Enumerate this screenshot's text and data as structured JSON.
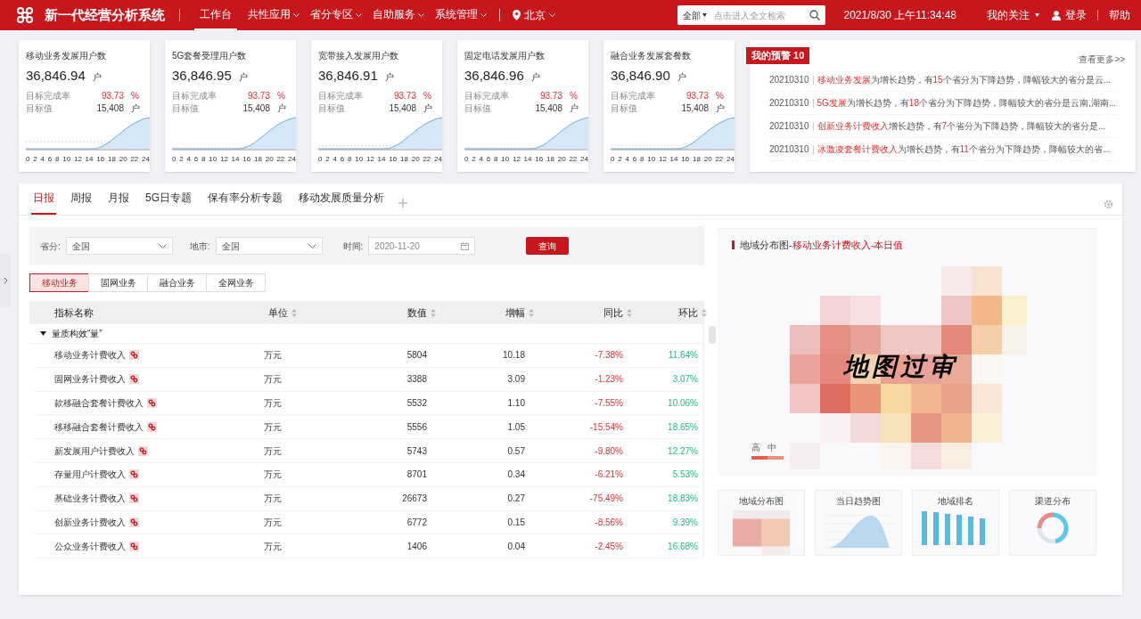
{
  "header": {
    "title": "新一代经营分析系统",
    "nav": [
      {
        "label": "工作台",
        "selected": true,
        "dropdown": false
      },
      {
        "label": "共性应用",
        "selected": false,
        "dropdown": true
      },
      {
        "label": "省分专区",
        "selected": false,
        "dropdown": true
      },
      {
        "label": "自助服务",
        "selected": false,
        "dropdown": true
      },
      {
        "label": "系统管理",
        "selected": false,
        "dropdown": true
      }
    ],
    "location": "北京",
    "search": {
      "scope": "全部",
      "placeholder": "点击进入全文检索"
    },
    "datetime": "2021/8/30 上午11:34:48",
    "follow": "我的关注",
    "login": "登录",
    "help": "帮助"
  },
  "kpi_cards": [
    {
      "title": "移动业务发展用户数",
      "value": "36,846.94",
      "unit": "户",
      "rate_label": "目标完成率",
      "rate": "93.73",
      "rate_unit": "%",
      "target_label": "目标值",
      "target": "15,408",
      "target_unit": "户",
      "axis": "0 2 4 6 8 10 12 14 16 18 20 22 24"
    },
    {
      "title": "5G套餐受理用户数",
      "value": "36,846.95",
      "unit": "户",
      "rate_label": "目标完成率",
      "rate": "93.73",
      "rate_unit": "%",
      "target_label": "目标值",
      "target": "15,408",
      "target_unit": "户",
      "axis": "0 2 4 6 8 10 12 14 16 18 20 22 24"
    },
    {
      "title": "宽带接入发展用户数",
      "value": "36,846.91",
      "unit": "户",
      "rate_label": "目标完成率",
      "rate": "93.73",
      "rate_unit": "%",
      "target_label": "目标值",
      "target": "15,408",
      "target_unit": "户",
      "axis": "0 2 4 6 8 10 12 14 16 18 20 22 24"
    },
    {
      "title": "固定电话发展用户数",
      "value": "36,846.96",
      "unit": "户",
      "rate_label": "目标完成率",
      "rate": "93.73",
      "rate_unit": "%",
      "target_label": "目标值",
      "target": "15,408",
      "target_unit": "户",
      "axis": "0 2 4 6 8 10 12 14 16 18 20 22 24"
    },
    {
      "title": "融合业务发展套餐数",
      "value": "36,846.90",
      "unit": "户",
      "rate_label": "目标完成率",
      "rate": "93.73",
      "rate_unit": "%",
      "target_label": "目标值",
      "target": "15,408",
      "target_unit": "户",
      "axis": "0 2 4 6 8 10 12 14 16 18 20 22 24"
    }
  ],
  "alerts": {
    "title": "我的预警 10",
    "more": "查看更多>>",
    "items": [
      {
        "date": "20210310",
        "text": "**移动业务发展**为增长趋势，有**15**个省分为下降趋势，降幅较大的省分是云..."
      },
      {
        "date": "20210310",
        "text": "**5G发展**为增长趋势，有**18**个省分为下降趋势，降幅较大的省分是云南,湖南..."
      },
      {
        "date": "20210310",
        "text": "**创新业务计费收入**增长趋势，有**7**个省分为下降趋势，降幅较大的省分是..."
      },
      {
        "date": "20210310",
        "text": "**冰激凌套餐计费收入**为增长趋势，有**11**个省分为下降趋势，降幅较大的省..."
      }
    ]
  },
  "report_tabs": [
    {
      "label": "日报",
      "selected": true
    },
    {
      "label": "周报",
      "selected": false
    },
    {
      "label": "月报",
      "selected": false
    },
    {
      "label": "5G日专题",
      "selected": false
    },
    {
      "label": "保有率分析专题",
      "selected": false
    },
    {
      "label": "移动发展质量分析",
      "selected": false
    }
  ],
  "filters": {
    "province_label": "省分:",
    "province": "全国",
    "city_label": "地市:",
    "city": "全国",
    "time_label": "时间:",
    "time": "2020-11-20",
    "query": "查询"
  },
  "business_tabs": [
    {
      "label": "移动业务",
      "selected": true
    },
    {
      "label": "固网业务",
      "selected": false
    },
    {
      "label": "融合业务",
      "selected": false
    },
    {
      "label": "全网业务",
      "selected": false
    }
  ],
  "table": {
    "columns": [
      "指标名称",
      "单位",
      "数值",
      "增幅",
      "同比",
      "环比"
    ],
    "group": {
      "label": "量质构效“量”",
      "expanded": true
    },
    "rows": [
      [
        "移动业务计费收入",
        "万元",
        "5804",
        "10.18",
        "-7.38%",
        "11.64%"
      ],
      [
        "固网业务计费收入",
        "万元",
        "3388",
        "3.09",
        "-1.23%",
        "3.07%"
      ],
      [
        "款移融合套餐计费收入",
        "万元",
        "5532",
        "1.10",
        "-7.55%",
        "10.06%"
      ],
      [
        "移移融合套餐计费收入",
        "万元",
        "5556",
        "1.05",
        "-15.54%",
        "18.65%"
      ],
      [
        "新发展用户计费收入",
        "万元",
        "5743",
        "0.57",
        "-9.80%",
        "12.27%"
      ],
      [
        "存量用户计费收入",
        "万元",
        "8701",
        "0.34",
        "-6.21%",
        "5.53%"
      ],
      [
        "基础业务计费收入",
        "万元",
        "26673",
        "0.27",
        "-75.49%",
        "18.83%"
      ],
      [
        "创新业务计费收入",
        "万元",
        "6772",
        "0.15",
        "-8.56%",
        "9.39%"
      ],
      [
        "公众业务计费收入",
        "万元",
        "1406",
        "0.04",
        "-2.45%",
        "16.68%"
      ]
    ]
  },
  "map_panel": {
    "title": "地域分布图-",
    "subtitle": "移动业务计费收入-本日值",
    "overlay": "地图过审",
    "legend": [
      "高",
      "中"
    ]
  },
  "thumbnails": [
    {
      "title": "地域分布图",
      "kind": "map"
    },
    {
      "title": "当日趋势图",
      "kind": "area"
    },
    {
      "title": "地域排名",
      "kind": "bar"
    },
    {
      "title": "渠道分布",
      "kind": "donut"
    }
  ]
}
